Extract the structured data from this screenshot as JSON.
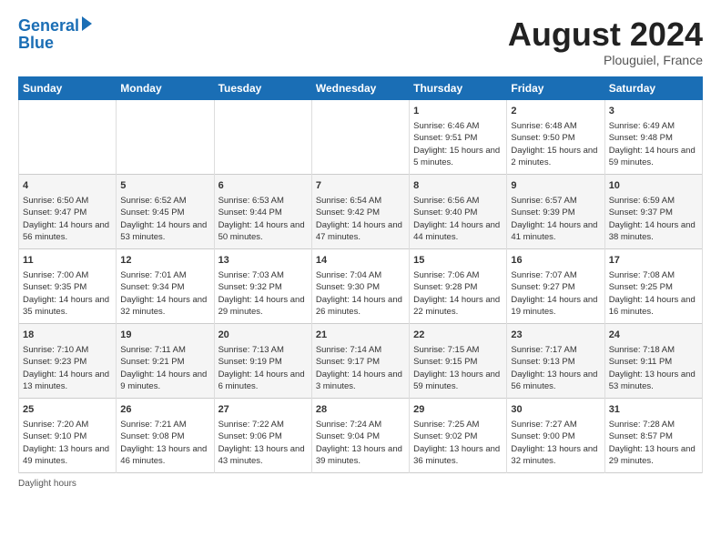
{
  "header": {
    "logo_line1": "General",
    "logo_line2": "Blue",
    "month_year": "August 2024",
    "location": "Plouguiel, France"
  },
  "days_of_week": [
    "Sunday",
    "Monday",
    "Tuesday",
    "Wednesday",
    "Thursday",
    "Friday",
    "Saturday"
  ],
  "weeks": [
    [
      {
        "num": "",
        "content": ""
      },
      {
        "num": "",
        "content": ""
      },
      {
        "num": "",
        "content": ""
      },
      {
        "num": "",
        "content": ""
      },
      {
        "num": "1",
        "content": "Sunrise: 6:46 AM\nSunset: 9:51 PM\nDaylight: 15 hours and 5 minutes."
      },
      {
        "num": "2",
        "content": "Sunrise: 6:48 AM\nSunset: 9:50 PM\nDaylight: 15 hours and 2 minutes."
      },
      {
        "num": "3",
        "content": "Sunrise: 6:49 AM\nSunset: 9:48 PM\nDaylight: 14 hours and 59 minutes."
      }
    ],
    [
      {
        "num": "4",
        "content": "Sunrise: 6:50 AM\nSunset: 9:47 PM\nDaylight: 14 hours and 56 minutes."
      },
      {
        "num": "5",
        "content": "Sunrise: 6:52 AM\nSunset: 9:45 PM\nDaylight: 14 hours and 53 minutes."
      },
      {
        "num": "6",
        "content": "Sunrise: 6:53 AM\nSunset: 9:44 PM\nDaylight: 14 hours and 50 minutes."
      },
      {
        "num": "7",
        "content": "Sunrise: 6:54 AM\nSunset: 9:42 PM\nDaylight: 14 hours and 47 minutes."
      },
      {
        "num": "8",
        "content": "Sunrise: 6:56 AM\nSunset: 9:40 PM\nDaylight: 14 hours and 44 minutes."
      },
      {
        "num": "9",
        "content": "Sunrise: 6:57 AM\nSunset: 9:39 PM\nDaylight: 14 hours and 41 minutes."
      },
      {
        "num": "10",
        "content": "Sunrise: 6:59 AM\nSunset: 9:37 PM\nDaylight: 14 hours and 38 minutes."
      }
    ],
    [
      {
        "num": "11",
        "content": "Sunrise: 7:00 AM\nSunset: 9:35 PM\nDaylight: 14 hours and 35 minutes."
      },
      {
        "num": "12",
        "content": "Sunrise: 7:01 AM\nSunset: 9:34 PM\nDaylight: 14 hours and 32 minutes."
      },
      {
        "num": "13",
        "content": "Sunrise: 7:03 AM\nSunset: 9:32 PM\nDaylight: 14 hours and 29 minutes."
      },
      {
        "num": "14",
        "content": "Sunrise: 7:04 AM\nSunset: 9:30 PM\nDaylight: 14 hours and 26 minutes."
      },
      {
        "num": "15",
        "content": "Sunrise: 7:06 AM\nSunset: 9:28 PM\nDaylight: 14 hours and 22 minutes."
      },
      {
        "num": "16",
        "content": "Sunrise: 7:07 AM\nSunset: 9:27 PM\nDaylight: 14 hours and 19 minutes."
      },
      {
        "num": "17",
        "content": "Sunrise: 7:08 AM\nSunset: 9:25 PM\nDaylight: 14 hours and 16 minutes."
      }
    ],
    [
      {
        "num": "18",
        "content": "Sunrise: 7:10 AM\nSunset: 9:23 PM\nDaylight: 14 hours and 13 minutes."
      },
      {
        "num": "19",
        "content": "Sunrise: 7:11 AM\nSunset: 9:21 PM\nDaylight: 14 hours and 9 minutes."
      },
      {
        "num": "20",
        "content": "Sunrise: 7:13 AM\nSunset: 9:19 PM\nDaylight: 14 hours and 6 minutes."
      },
      {
        "num": "21",
        "content": "Sunrise: 7:14 AM\nSunset: 9:17 PM\nDaylight: 14 hours and 3 minutes."
      },
      {
        "num": "22",
        "content": "Sunrise: 7:15 AM\nSunset: 9:15 PM\nDaylight: 13 hours and 59 minutes."
      },
      {
        "num": "23",
        "content": "Sunrise: 7:17 AM\nSunset: 9:13 PM\nDaylight: 13 hours and 56 minutes."
      },
      {
        "num": "24",
        "content": "Sunrise: 7:18 AM\nSunset: 9:11 PM\nDaylight: 13 hours and 53 minutes."
      }
    ],
    [
      {
        "num": "25",
        "content": "Sunrise: 7:20 AM\nSunset: 9:10 PM\nDaylight: 13 hours and 49 minutes."
      },
      {
        "num": "26",
        "content": "Sunrise: 7:21 AM\nSunset: 9:08 PM\nDaylight: 13 hours and 46 minutes."
      },
      {
        "num": "27",
        "content": "Sunrise: 7:22 AM\nSunset: 9:06 PM\nDaylight: 13 hours and 43 minutes."
      },
      {
        "num": "28",
        "content": "Sunrise: 7:24 AM\nSunset: 9:04 PM\nDaylight: 13 hours and 39 minutes."
      },
      {
        "num": "29",
        "content": "Sunrise: 7:25 AM\nSunset: 9:02 PM\nDaylight: 13 hours and 36 minutes."
      },
      {
        "num": "30",
        "content": "Sunrise: 7:27 AM\nSunset: 9:00 PM\nDaylight: 13 hours and 32 minutes."
      },
      {
        "num": "31",
        "content": "Sunrise: 7:28 AM\nSunset: 8:57 PM\nDaylight: 13 hours and 29 minutes."
      }
    ]
  ],
  "footer": {
    "daylight_label": "Daylight hours"
  }
}
